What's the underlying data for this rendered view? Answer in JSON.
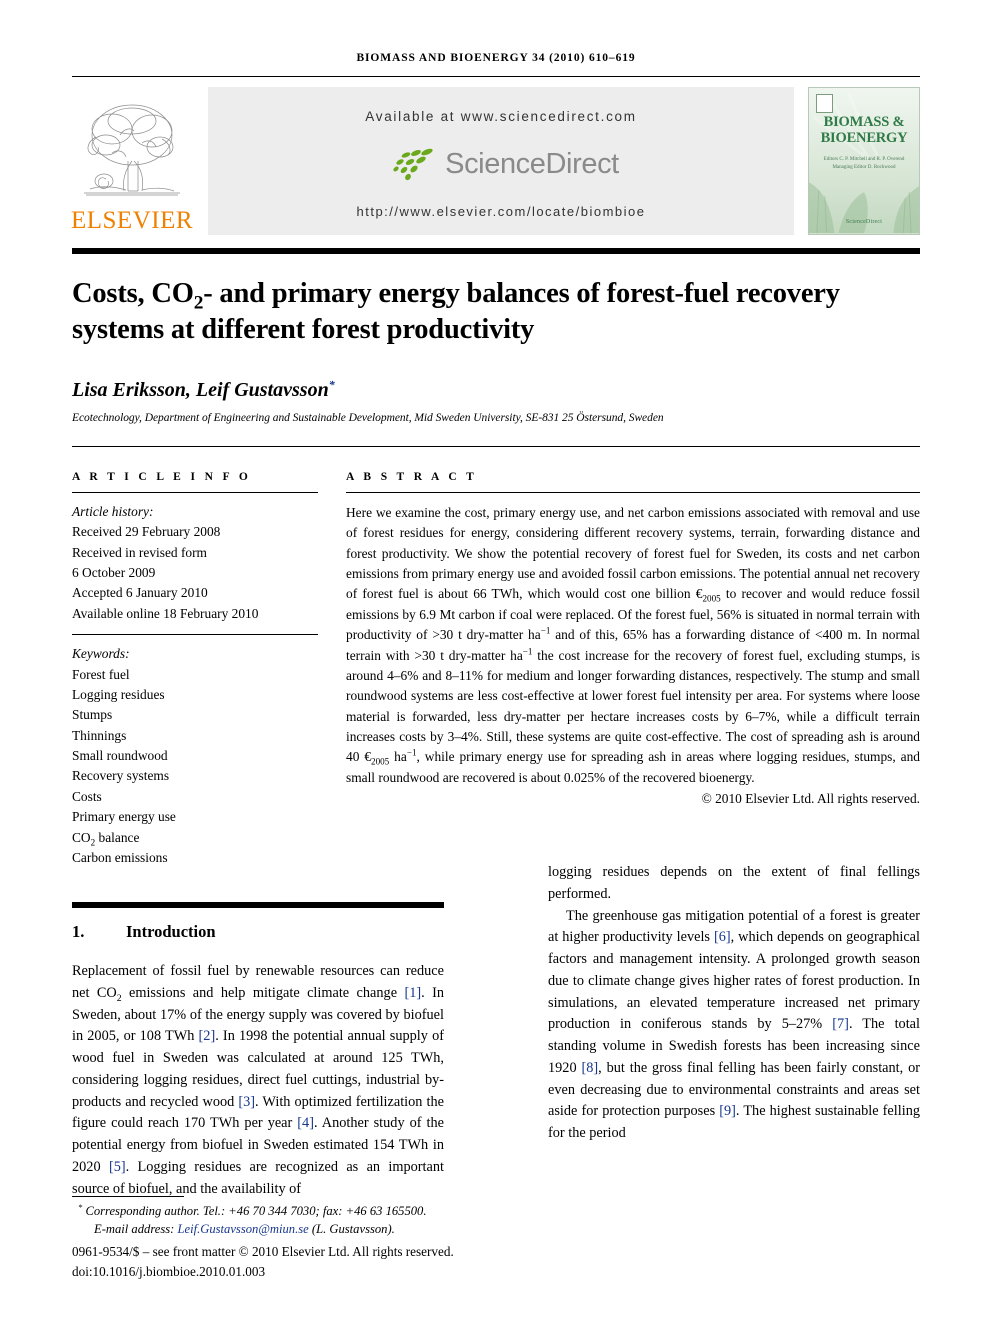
{
  "running_head": "BIOMASS AND BIOENERGY 34 (2010) 610–619",
  "masthead": {
    "publisher_name": "ELSEVIER",
    "available_at": "Available at www.sciencedirect.com",
    "sciencedirect_wordmark": "ScienceDirect",
    "journal_url": "http://www.elsevier.com/locate/biombioe",
    "cover": {
      "title_line1": "BIOMASS &",
      "title_line2": "BIOENERGY",
      "editors": "Editors C. P. Mitchell and R. P. Overend\nManaging Editor D. Rockwood",
      "footer": "ScienceDirect"
    }
  },
  "article": {
    "title": "Costs, CO2- and primary energy balances of forest-fuel recovery systems at different forest productivity",
    "title_parts": {
      "a": "Costs, CO",
      "sub": "2",
      "b": "- and primary energy balances of forest-fuel recovery systems at different forest productivity"
    },
    "authors": "Lisa Eriksson, Leif Gustavsson",
    "corresponding_marker": "*",
    "affiliation": "Ecotechnology, Department of Engineering and Sustainable Development, Mid Sweden University, SE-831 25 Östersund, Sweden"
  },
  "article_info": {
    "heading": "A R T I C L E  I N F O",
    "history_label": "Article history:",
    "history": [
      "Received 29 February 2008",
      "Received in revised form",
      "6 October 2009",
      "Accepted 6 January 2010",
      "Available online 18 February 2010"
    ],
    "keywords_label": "Keywords:",
    "keywords": [
      "Forest fuel",
      "Logging residues",
      "Stumps",
      "Thinnings",
      "Small roundwood",
      "Recovery systems",
      "Costs",
      "Primary energy use",
      "CO2 balance",
      "Carbon emissions"
    ]
  },
  "abstract": {
    "heading": "A B S T R A C T",
    "paragraph_1": "Here we examine the cost, primary energy use, and net carbon emissions associated with removal and use of forest residues for energy, considering different recovery systems, terrain, forwarding distance and forest productivity. We show the potential recovery of forest fuel for Sweden, its costs and net carbon emissions from primary energy use and avoided fossil carbon emissions. The potential annual net recovery of forest fuel is about 66 TWh, which would cost one billion €",
    "euro_sub_1": "2005",
    "paragraph_2": " to recover and would reduce fossil emissions by 6.9 Mt carbon if coal were replaced. Of the forest fuel, 56% is situated in normal terrain with productivity of >30 t dry-matter ha",
    "sup_1": "−1",
    "paragraph_3": " and of this, 65% has a forwarding distance of <400 m. In normal terrain with >30 t dry-matter ha",
    "sup_2": "−1",
    "paragraph_4": " the cost increase for the recovery of forest fuel, excluding stumps, is around 4–6% and 8–11% for medium and longer forwarding distances, respectively. The stump and small roundwood systems are less cost-effective at lower forest fuel intensity per area. For systems where loose material is forwarded, less dry-matter per hectare increases costs by 6–7%, while a difficult terrain increases costs by 3–4%. Still, these systems are quite cost-effective. The cost of spreading ash is around 40 €",
    "euro_sub_2": "2005",
    "paragraph_5": " ha",
    "sup_3": "−1",
    "paragraph_6": ", while primary energy use for spreading ash in areas where logging residues, stumps, and small roundwood are recovered is about 0.025% of the recovered bioenergy.",
    "copyright": "© 2010 Elsevier Ltd. All rights reserved."
  },
  "section": {
    "number": "1.",
    "title": "Introduction"
  },
  "body": {
    "left": {
      "p1_a": "Replacement of fossil fuel by renewable resources can reduce net CO",
      "p1_sub": "2",
      "p1_b": " emissions and help mitigate climate change ",
      "ref1": "[1]",
      "p1_c": ". In Sweden, about 17% of the energy supply was covered by biofuel in 2005, or 108 TWh ",
      "ref2": "[2]",
      "p1_d": ". In 1998 the potential annual supply of wood fuel in Sweden was calculated at around 125 TWh, considering logging residues, direct fuel cuttings, industrial by-products and recycled wood ",
      "ref3": "[3]",
      "p1_e": ". With optimized fertilization the figure could reach 170 TWh per year ",
      "ref4": "[4]",
      "p1_f": ". Another study of the potential energy from biofuel in Sweden estimated 154 TWh in 2020 ",
      "ref5": "[5]",
      "p1_g": ". Logging residues are recognized as an important source of biofuel, and the availability of"
    },
    "right": {
      "p1_cont": "logging residues depends on the extent of final fellings performed.",
      "p2_a": "The greenhouse gas mitigation potential of a forest is greater at higher productivity levels ",
      "ref6": "[6]",
      "p2_b": ", which depends on geographical factors and management intensity. A prolonged growth season due to climate change gives higher rates of forest production. In simulations, an elevated temperature increased net primary production in coniferous stands by 5–27% ",
      "ref7": "[7]",
      "p2_c": ". The total standing volume in Swedish forests has been increasing since 1920 ",
      "ref8": "[8]",
      "p2_d": ", but the gross final felling has been fairly constant, or even decreasing due to environmental constraints and areas set aside for protection purposes ",
      "ref9": "[9]",
      "p2_e": ". The highest sustainable felling for the period"
    }
  },
  "footnotes": {
    "corresponding": "Corresponding author. Tel.: +46 70 344 7030; fax: +46 63 165500.",
    "email_label": "E-mail address:",
    "email": "Leif.Gustavsson@miun.se",
    "email_suffix": "(L. Gustavsson).",
    "issn_line": "0961-9534/$ – see front matter © 2010 Elsevier Ltd. All rights reserved.",
    "doi_line": "doi:10.1016/j.biombioe.2010.01.003"
  },
  "colors": {
    "reference_link": "#16368c",
    "elsevier_orange": "#F08000",
    "sciencedirect_green": "#6aa81c",
    "journal_green": "#2f7a46",
    "banner_gray": "#ededed"
  }
}
